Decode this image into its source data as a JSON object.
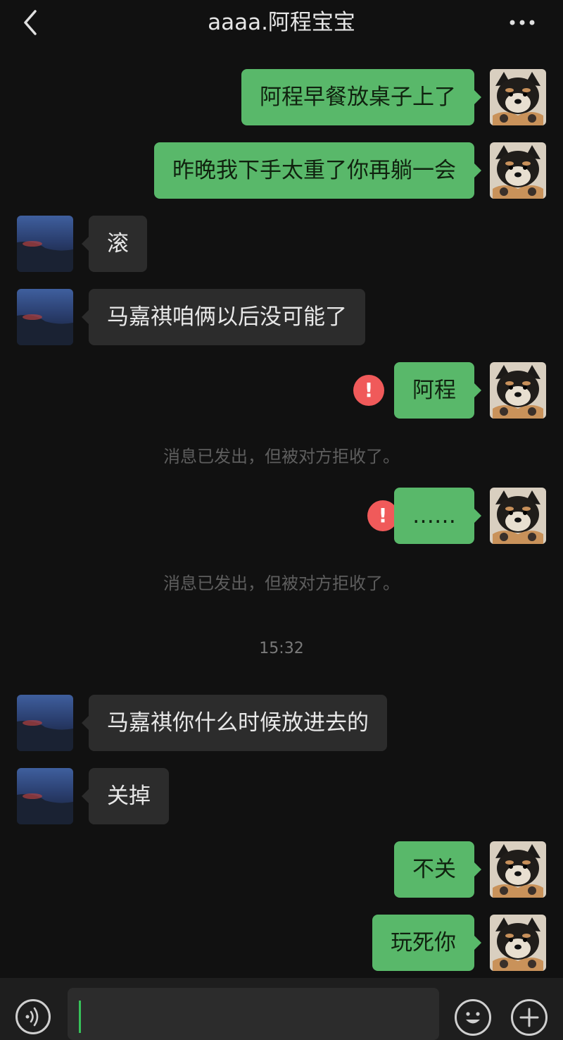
{
  "header": {
    "title": "aaaa.阿程宝宝",
    "back_icon": "chevron-left-icon",
    "more_icon": "more-dots-icon"
  },
  "messages": [
    {
      "side": "out",
      "text": "阿程早餐放桌子上了"
    },
    {
      "side": "out",
      "text": "昨晚我下手太重了你再躺一会"
    },
    {
      "side": "in",
      "text": "滚"
    },
    {
      "side": "in",
      "text": "马嘉祺咱俩以后没可能了"
    },
    {
      "side": "out",
      "text": "阿程",
      "error": true
    },
    {
      "side": "out",
      "text": "……",
      "error": true
    },
    {
      "side": "in",
      "text": "马嘉祺你什么时候放进去的"
    },
    {
      "side": "in",
      "text": "关掉"
    },
    {
      "side": "out",
      "text": "不关"
    },
    {
      "side": "out",
      "text": "玩死你"
    }
  ],
  "system_notes": {
    "rejected_1": "消息已发出，但被对方拒收了。",
    "rejected_2": "消息已发出，但被对方拒收了。"
  },
  "timestamp": "15:32",
  "error_mark": "!",
  "input_bar": {
    "voice_icon": "voice-icon",
    "emoji_icon": "emoji-icon",
    "plus_icon": "plus-icon"
  },
  "colors": {
    "background": "#111111",
    "outgoing_bubble": "#59b86a",
    "incoming_bubble": "#2c2c2c",
    "error": "#f05a5a",
    "cursor": "#37c25a"
  }
}
